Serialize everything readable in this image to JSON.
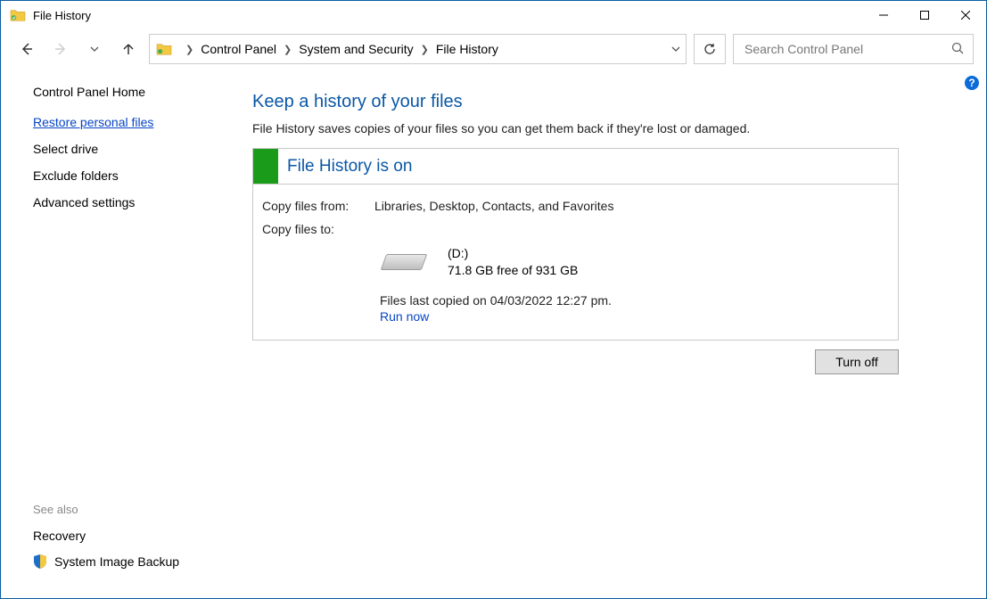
{
  "window": {
    "title": "File History"
  },
  "breadcrumb": {
    "item1": "Control Panel",
    "item2": "System and Security",
    "item3": "File History"
  },
  "search": {
    "placeholder": "Search Control Panel"
  },
  "sidebar": {
    "home": "Control Panel Home",
    "links": {
      "restore": "Restore personal files",
      "select_drive": "Select drive",
      "exclude": "Exclude folders",
      "advanced": "Advanced settings"
    },
    "see_also_label": "See also",
    "see_also": {
      "recovery": "Recovery",
      "sysimg": "System Image Backup"
    }
  },
  "main": {
    "title": "Keep a history of your files",
    "subtitle": "File History saves copies of your files so you can get them back if they're lost or damaged.",
    "status_title": "File History is on",
    "copy_from_label": "Copy files from:",
    "copy_from_value": "Libraries, Desktop, Contacts, and Favorites",
    "copy_to_label": "Copy files to:",
    "drive_name": "(D:)",
    "drive_space": "71.8 GB free of 931 GB",
    "last_copied": "Files last copied on 04/03/2022 12:27 pm.",
    "run_now": "Run now",
    "turn_off": "Turn off"
  }
}
